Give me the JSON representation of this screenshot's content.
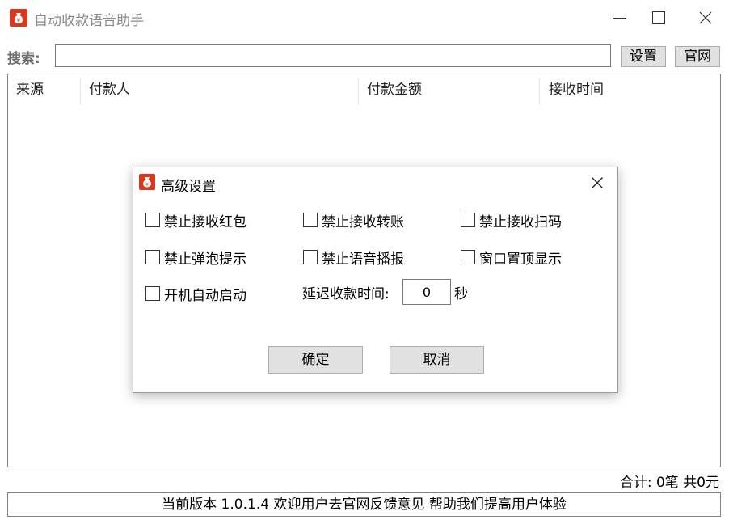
{
  "window": {
    "title": "自动收款语音助手",
    "accent_color": "#d9381e"
  },
  "search": {
    "label": "搜索:",
    "value": "",
    "settings_button": "设置",
    "website_button": "官网"
  },
  "table": {
    "columns": [
      "来源",
      "付款人",
      "付款金额",
      "接收时间"
    ],
    "rows": []
  },
  "summary": {
    "text": "合计: 0笔  共0元"
  },
  "status": {
    "text": "当前版本 1.0.1.4 欢迎用户去官网反馈意见 帮助我们提高用户体验"
  },
  "dialog": {
    "title": "高级设置",
    "options": [
      {
        "label": "禁止接收红包",
        "checked": false
      },
      {
        "label": "禁止接收转账",
        "checked": false
      },
      {
        "label": "禁止接收扫码",
        "checked": false
      },
      {
        "label": "禁止弹泡提示",
        "checked": false
      },
      {
        "label": "禁止语音播报",
        "checked": false
      },
      {
        "label": "窗口置顶显示",
        "checked": false
      },
      {
        "label": "开机自动启动",
        "checked": false
      }
    ],
    "delay": {
      "label": "延迟收款时间:",
      "value": "0",
      "unit": "秒"
    },
    "ok_button": "确定",
    "cancel_button": "取消"
  }
}
